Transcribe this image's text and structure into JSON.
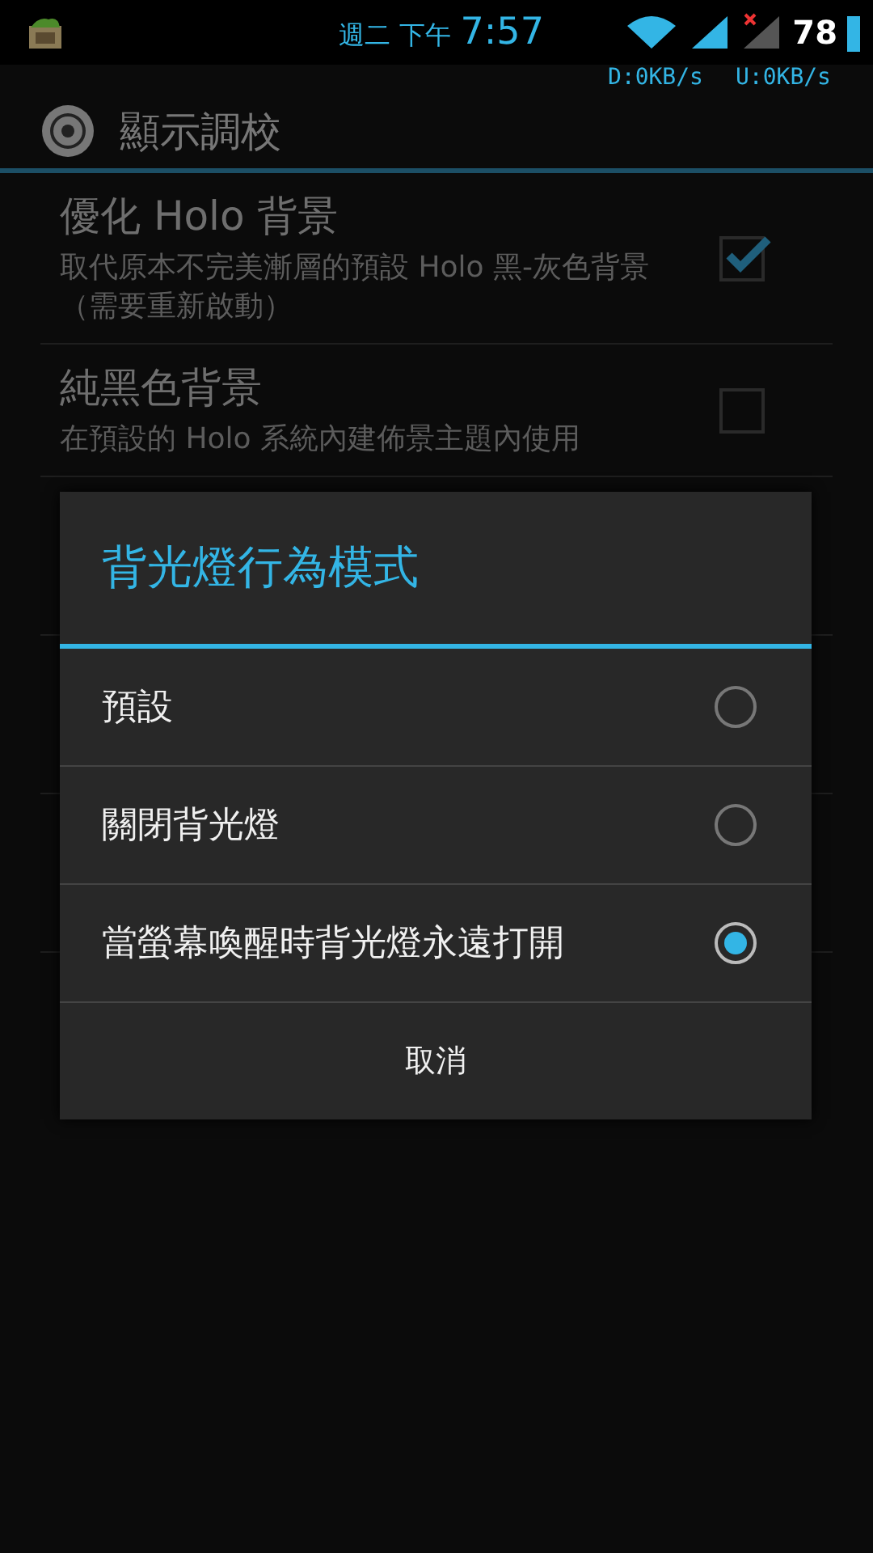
{
  "status_bar": {
    "day": "週二 下午",
    "time": "7:57",
    "battery": "78",
    "net_down": "D:0KB/s",
    "net_up": "U:0KB/s"
  },
  "action_bar": {
    "title": "顯示調校"
  },
  "preferences": [
    {
      "title": "優化 Holo 背景",
      "summary": "取代原本不完美漸層的預設 Holo 黑-灰色背景（需要重新啟動）",
      "checked": true
    },
    {
      "title": "純黑色背景",
      "summary": "在預設的 Holo 系統內建佈景主題內使用",
      "checked": false
    }
  ],
  "dialog": {
    "title": "背光燈行為模式",
    "options": [
      {
        "label": "預設",
        "selected": false
      },
      {
        "label": "關閉背光燈",
        "selected": false
      },
      {
        "label": "當螢幕喚醒時背光燈永遠打開",
        "selected": true
      }
    ],
    "cancel": "取消"
  }
}
